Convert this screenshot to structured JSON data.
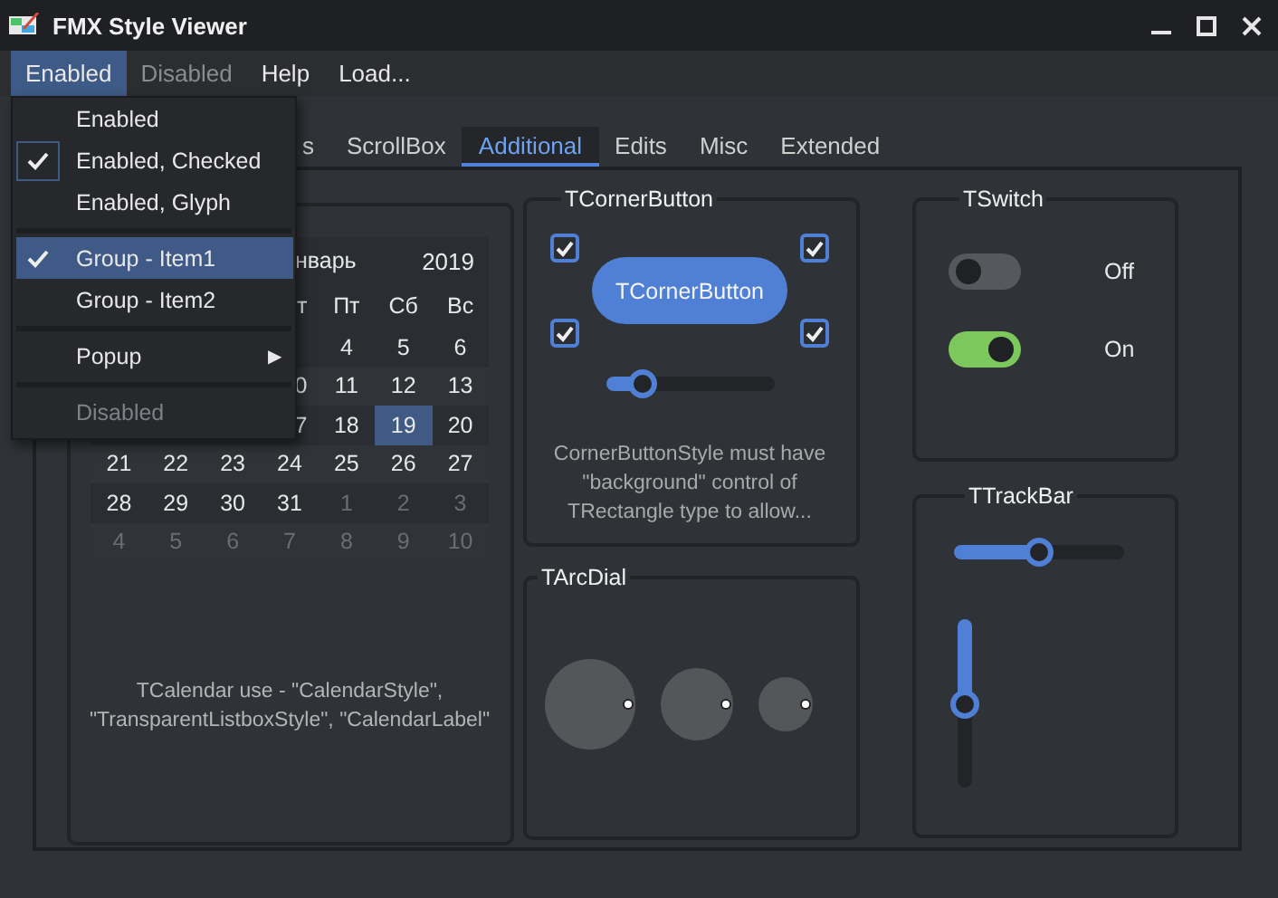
{
  "window": {
    "title": "FMX Style Viewer"
  },
  "menu_bar": [
    {
      "label": "Enabled",
      "selected": true,
      "disabled": false
    },
    {
      "label": "Disabled",
      "selected": false,
      "disabled": true
    },
    {
      "label": "Help",
      "selected": false,
      "disabled": false
    },
    {
      "label": "Load...",
      "selected": false,
      "disabled": false
    }
  ],
  "menu_popup": [
    {
      "kind": "item",
      "label": "Enabled",
      "checked": false,
      "selected": false,
      "disabled": false
    },
    {
      "kind": "item",
      "label": "Enabled, Checked",
      "checked": true,
      "selected": false,
      "disabled": false
    },
    {
      "kind": "item",
      "label": "Enabled, Glyph",
      "checked": false,
      "selected": false,
      "disabled": false
    },
    {
      "kind": "separator"
    },
    {
      "kind": "item",
      "label": "Group - Item1",
      "checked": true,
      "selected": true,
      "disabled": false
    },
    {
      "kind": "item",
      "label": "Group - Item2",
      "checked": false,
      "selected": false,
      "disabled": false
    },
    {
      "kind": "separator"
    },
    {
      "kind": "submenu",
      "label": "Popup",
      "arrow": "▶",
      "checked": false,
      "selected": false,
      "disabled": false
    },
    {
      "kind": "separator"
    },
    {
      "kind": "item",
      "label": "Disabled",
      "checked": false,
      "selected": false,
      "disabled": true
    }
  ],
  "tabs": [
    {
      "label": "s",
      "selected": false
    },
    {
      "label": "ScrollBox",
      "selected": false
    },
    {
      "label": "Additional",
      "selected": true
    },
    {
      "label": "Edits",
      "selected": false
    },
    {
      "label": "Misc",
      "selected": false
    },
    {
      "label": "Extended",
      "selected": false
    }
  ],
  "calendar": {
    "month": "нварь",
    "year": "2019",
    "weekdays": [
      {
        "label": "т",
        "cut": true
      },
      {
        "label": "Пт",
        "cut": false
      },
      {
        "label": "Сб",
        "cut": false
      },
      {
        "label": "Вс",
        "cut": false
      }
    ],
    "weeks": [
      [
        {
          "day": "4",
          "in_month": true,
          "selected": false,
          "cut": false
        },
        {
          "day": "5",
          "in_month": true,
          "selected": false,
          "cut": false
        },
        {
          "day": "6",
          "in_month": true,
          "selected": false,
          "cut": false
        }
      ],
      [
        {
          "day": "0",
          "in_month": true,
          "selected": false,
          "cut": true
        },
        {
          "day": "11",
          "in_month": true,
          "selected": false,
          "cut": false
        },
        {
          "day": "12",
          "in_month": true,
          "selected": false,
          "cut": false
        },
        {
          "day": "13",
          "in_month": true,
          "selected": false,
          "cut": false
        }
      ],
      [
        {
          "day": "7",
          "in_month": true,
          "selected": false,
          "cut": true
        },
        {
          "day": "18",
          "in_month": true,
          "selected": false,
          "cut": false
        },
        {
          "day": "19",
          "in_month": true,
          "selected": true,
          "cut": false
        },
        {
          "day": "20",
          "in_month": true,
          "selected": false,
          "cut": false
        }
      ],
      [
        {
          "day": "21",
          "in_month": true,
          "selected": false,
          "cut": false
        },
        {
          "day": "22",
          "in_month": true,
          "selected": false,
          "cut": false
        },
        {
          "day": "23",
          "in_month": true,
          "selected": false,
          "cut": false
        },
        {
          "day": "24",
          "in_month": true,
          "selected": false,
          "cut": false
        },
        {
          "day": "25",
          "in_month": true,
          "selected": false,
          "cut": false
        },
        {
          "day": "26",
          "in_month": true,
          "selected": false,
          "cut": false
        },
        {
          "day": "27",
          "in_month": true,
          "selected": false,
          "cut": false
        }
      ],
      [
        {
          "day": "28",
          "in_month": true,
          "selected": false,
          "cut": false
        },
        {
          "day": "29",
          "in_month": true,
          "selected": false,
          "cut": false
        },
        {
          "day": "30",
          "in_month": true,
          "selected": false,
          "cut": false
        },
        {
          "day": "31",
          "in_month": true,
          "selected": false,
          "cut": false
        },
        {
          "day": "1",
          "in_month": false,
          "selected": false,
          "cut": false
        },
        {
          "day": "2",
          "in_month": false,
          "selected": false,
          "cut": false
        },
        {
          "day": "3",
          "in_month": false,
          "selected": false,
          "cut": false
        }
      ],
      [
        {
          "day": "4",
          "in_month": false,
          "selected": false,
          "cut": false
        },
        {
          "day": "5",
          "in_month": false,
          "selected": false,
          "cut": false
        },
        {
          "day": "6",
          "in_month": false,
          "selected": false,
          "cut": false
        },
        {
          "day": "7",
          "in_month": false,
          "selected": false,
          "cut": false
        },
        {
          "day": "8",
          "in_month": false,
          "selected": false,
          "cut": false
        },
        {
          "day": "9",
          "in_month": false,
          "selected": false,
          "cut": false
        },
        {
          "day": "10",
          "in_month": false,
          "selected": false,
          "cut": false
        }
      ]
    ],
    "caption": "TCalendar use - \"CalendarStyle\", \"TransparentListboxStyle\", \"CalendarLabel\""
  },
  "corner_button": {
    "title": "TCornerButton",
    "button": "TCornerButton",
    "corners": [
      {
        "checked": true
      },
      {
        "checked": true
      },
      {
        "checked": true
      },
      {
        "checked": true
      }
    ],
    "slider": {
      "level": 0.22
    },
    "note": "CornerButtonStyle must have \"background\" control of TRectangle type to allow..."
  },
  "arc_dial": {
    "title": "TArcDial"
  },
  "switches": {
    "title": "TSwitch",
    "items": [
      {
        "on": false,
        "label": "Off"
      },
      {
        "on": true,
        "label": "On"
      }
    ]
  },
  "trackbar": {
    "title": "TTrackBar",
    "horizontal": {
      "level": 0.5
    },
    "vertical": {
      "level": 0.5
    }
  }
}
